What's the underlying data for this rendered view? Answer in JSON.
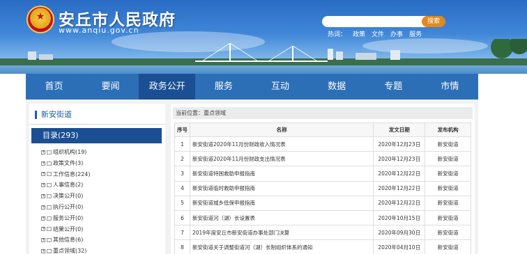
{
  "header": {
    "title": "安丘市人民政府",
    "url": "www.anqiu.gov.cn",
    "search_button": "搜索",
    "hot_label": "热词：",
    "hot_words": [
      "政策",
      "文件",
      "办事",
      "服务"
    ]
  },
  "nav": {
    "items": [
      "首页",
      "要闻",
      "政务公开",
      "服务",
      "互动",
      "数据",
      "专题",
      "市情"
    ],
    "active_index": 2
  },
  "sidebar": {
    "title": "新安街道",
    "directory": "目录(293)",
    "items": [
      "组织机构(19)",
      "政策文件(3)",
      "工作信息(224)",
      "人事信息(2)",
      "决策公开(0)",
      "执行公开(0)",
      "服务公开(0)",
      "结果公开(0)",
      "其他信息(6)",
      "重点领域(32)"
    ]
  },
  "main": {
    "breadcrumb": "当前位置：重点领域",
    "columns": [
      "序号",
      "名称",
      "发文日期",
      "发布机构"
    ],
    "rows": [
      [
        "1",
        "新安街道2020年11月份财政收入情况表",
        "2020年12月23日",
        "新安街道"
      ],
      [
        "2",
        "新安街道2020年11月份财政支出情况表",
        "2020年12月23日",
        "新安街道"
      ],
      [
        "3",
        "新安街道特困救助申报指南",
        "2020年12月22日",
        "新安街道"
      ],
      [
        "4",
        "新安街道临时救助申报指南",
        "2020年12月22日",
        "新安街道"
      ],
      [
        "5",
        "新安街道城乡低保申报指南",
        "2020年12月22日",
        "新安街道"
      ],
      [
        "6",
        "新安街道河（湖）长设置表",
        "2020年10月15日",
        "新安街道"
      ],
      [
        "7",
        "2019年度安丘市新安街道办事处部门决算",
        "2020年09月30日",
        "新安街道"
      ],
      [
        "8",
        "新安街道关于调整街道河（湖）长制组织体系的通知",
        "2020年04月10日",
        "新安街道"
      ]
    ]
  },
  "colors": {
    "nav": "#2c6fb7",
    "nav_active": "#1a4f93",
    "search_button": "#e1891f",
    "sidebar_title": "#1b5ba8"
  },
  "icons": {
    "emblem": "national-emblem",
    "tree_expand": "plus-box-icon",
    "tree_folder": "folder-icon"
  }
}
